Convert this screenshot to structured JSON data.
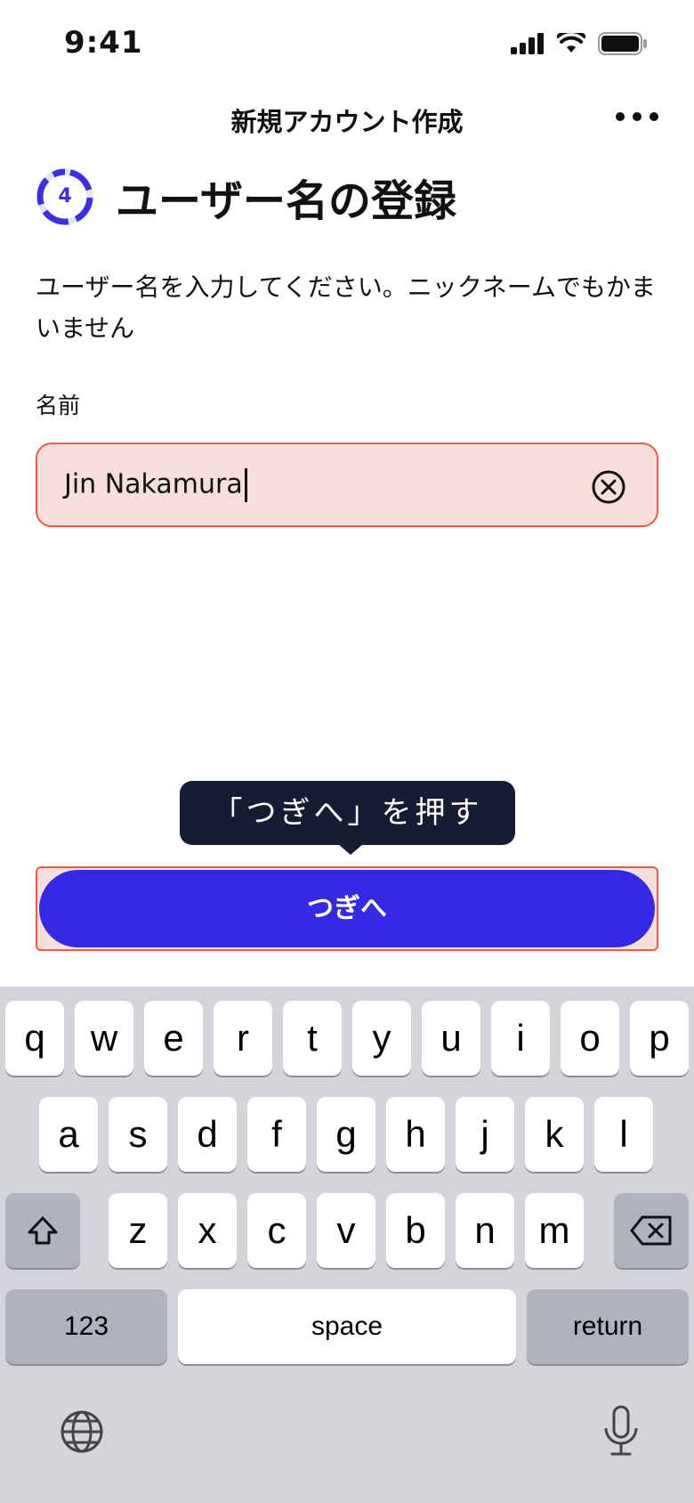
{
  "status_bar": {
    "time": "9:41"
  },
  "nav": {
    "title": "新規アカウント作成"
  },
  "header": {
    "step_number": "4",
    "title": "ユーザー名の登録"
  },
  "description": "ユーザー名を入力してください。ニックネームでもかまいません",
  "form": {
    "label": "名前",
    "value": "Jin Nakamura"
  },
  "tooltip": {
    "text": "「つぎへ」を押す"
  },
  "next_button": {
    "label": "つぎへ"
  },
  "keyboard": {
    "row1": [
      "q",
      "w",
      "e",
      "r",
      "t",
      "y",
      "u",
      "i",
      "o",
      "p"
    ],
    "row2": [
      "a",
      "s",
      "d",
      "f",
      "g",
      "h",
      "j",
      "k",
      "l"
    ],
    "row3": [
      "z",
      "x",
      "c",
      "v",
      "b",
      "n",
      "m"
    ],
    "numbers_label": "123",
    "space_label": "space",
    "return_label": "return"
  },
  "colors": {
    "accent": "#3629e6",
    "highlight_border": "#ea5a45",
    "highlight_fill": "#f6dfdb",
    "tooltip_bg": "#161d33"
  }
}
